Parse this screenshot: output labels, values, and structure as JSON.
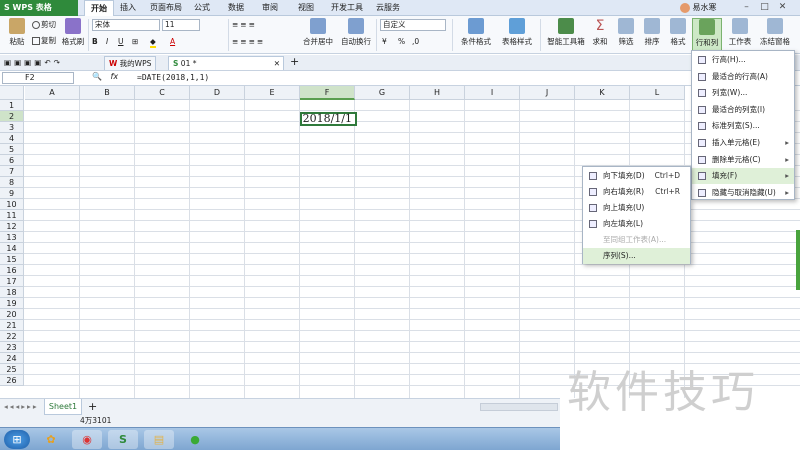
{
  "app": {
    "logo": "S WPS 表格",
    "user": "易水寒"
  },
  "ribbon_tabs": [
    "开始",
    "插入",
    "页面布局",
    "公式",
    "数据",
    "审阅",
    "视图",
    "开发工具",
    "云服务"
  ],
  "ribbon": {
    "paste": "粘贴",
    "cut": "剪切",
    "copy": "复制",
    "format_painter": "格式刷",
    "font_name": "宋体",
    "font_size": "11",
    "font_btns": [
      "B",
      "I",
      "U",
      "A"
    ],
    "merge_center": "合并居中",
    "wrap_text": "自动换行",
    "number_format": "自定义",
    "percent": "%",
    "cond_format": "条件格式",
    "table_style": "表格样式",
    "smart_toolbox": "智能工具箱",
    "sum": "求和",
    "filter": "筛选",
    "sort": "排序",
    "format": "格式",
    "row_col": "行和列",
    "worksheet": "工作表",
    "freeze": "冻结窗格"
  },
  "doc_tabs": [
    "我的WPS",
    "01 *"
  ],
  "formula_bar": {
    "name_box": "F2",
    "formula": "=DATE(2018,1,1)"
  },
  "grid": {
    "columns": [
      "A",
      "B",
      "C",
      "D",
      "E",
      "F",
      "G",
      "H",
      "I",
      "J",
      "K",
      "L"
    ],
    "rows": [
      "1",
      "2",
      "3",
      "4",
      "5",
      "6",
      "7",
      "8",
      "9",
      "10",
      "11",
      "12",
      "13",
      "14",
      "15",
      "16",
      "17",
      "18",
      "19",
      "20",
      "21",
      "22",
      "23",
      "24",
      "25",
      "26"
    ],
    "active_cell_value": "2018/1/1"
  },
  "sheet_tab": "Sheet1",
  "status": "4万3101",
  "menu_main": [
    {
      "label": "行高(H)...",
      "arrow": ""
    },
    {
      "label": "最适合的行高(A)",
      "arrow": ""
    },
    {
      "label": "列宽(W)...",
      "arrow": ""
    },
    {
      "label": "最适合的列宽(I)",
      "arrow": ""
    },
    {
      "label": "标准列宽(S)...",
      "arrow": ""
    },
    {
      "label": "插入单元格(E)",
      "arrow": "▸"
    },
    {
      "label": "删除单元格(C)",
      "arrow": "▸"
    },
    {
      "label": "填充(F)",
      "arrow": "▸"
    },
    {
      "label": "隐藏与取消隐藏(U)",
      "arrow": "▸"
    }
  ],
  "menu_fill": [
    {
      "label": "向下填充(D)",
      "shortcut": "Ctrl+D"
    },
    {
      "label": "向右填充(R)",
      "shortcut": "Ctrl+R"
    },
    {
      "label": "向上填充(U)",
      "shortcut": ""
    },
    {
      "label": "向左填充(L)",
      "shortcut": ""
    },
    {
      "label": "至同组工作表(A)...",
      "shortcut": ""
    },
    {
      "label": "序列(S)...",
      "shortcut": ""
    }
  ],
  "watermark": "软件技巧",
  "colors": {
    "accent": "#2f8a3b",
    "highlight": "#dff0d8"
  }
}
